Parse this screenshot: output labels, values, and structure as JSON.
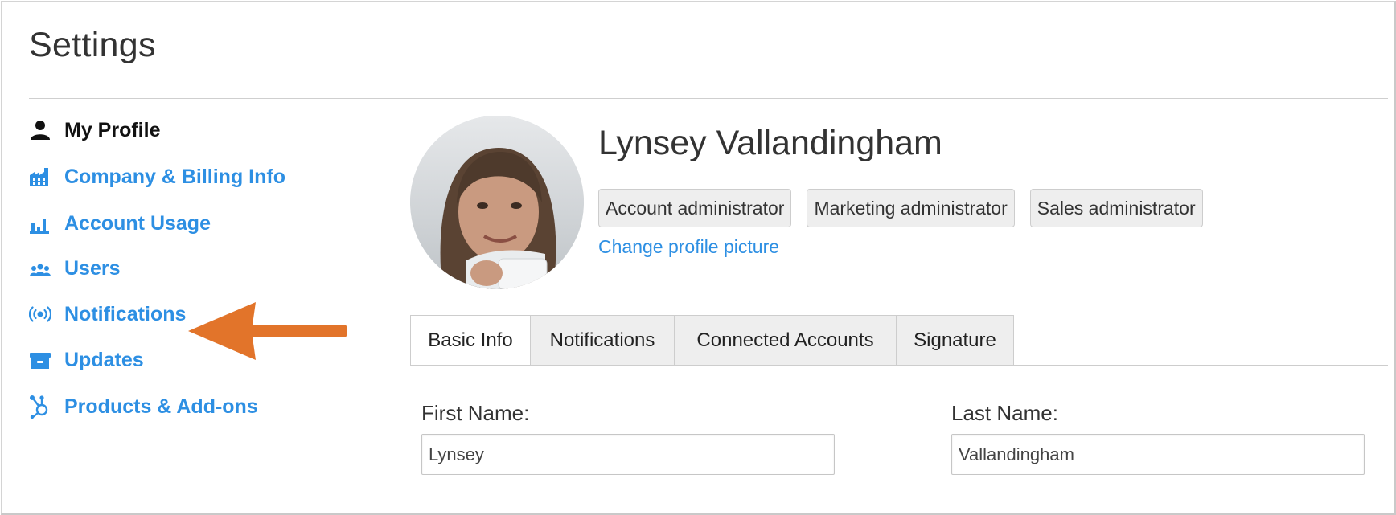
{
  "page": {
    "title": "Settings"
  },
  "sidebar": {
    "items": [
      {
        "label": "My Profile",
        "icon": "person-icon",
        "active": true
      },
      {
        "label": "Company & Billing Info",
        "icon": "factory-icon"
      },
      {
        "label": "Account Usage",
        "icon": "bar-chart-icon"
      },
      {
        "label": "Users",
        "icon": "users-icon"
      },
      {
        "label": "Notifications",
        "icon": "broadcast-icon"
      },
      {
        "label": "Updates",
        "icon": "archive-box-icon"
      },
      {
        "label": "Products & Add-ons",
        "icon": "hub-sprocket-icon"
      }
    ]
  },
  "profile": {
    "name": "Lynsey Vallandingham",
    "roles": [
      "Account administrator",
      "Marketing administrator",
      "Sales administrator"
    ],
    "change_picture_label": "Change profile picture"
  },
  "tabs": [
    {
      "label": "Basic Info",
      "active": true
    },
    {
      "label": "Notifications"
    },
    {
      "label": "Connected Accounts"
    },
    {
      "label": "Signature"
    }
  ],
  "form": {
    "first_name": {
      "label": "First Name:",
      "value": "Lynsey"
    },
    "last_name": {
      "label": "Last Name:",
      "value": "Vallandingham"
    }
  },
  "colors": {
    "link": "#2d8fe3",
    "annotation_arrow": "#e2742a",
    "badge_bg": "#eeeeee"
  }
}
